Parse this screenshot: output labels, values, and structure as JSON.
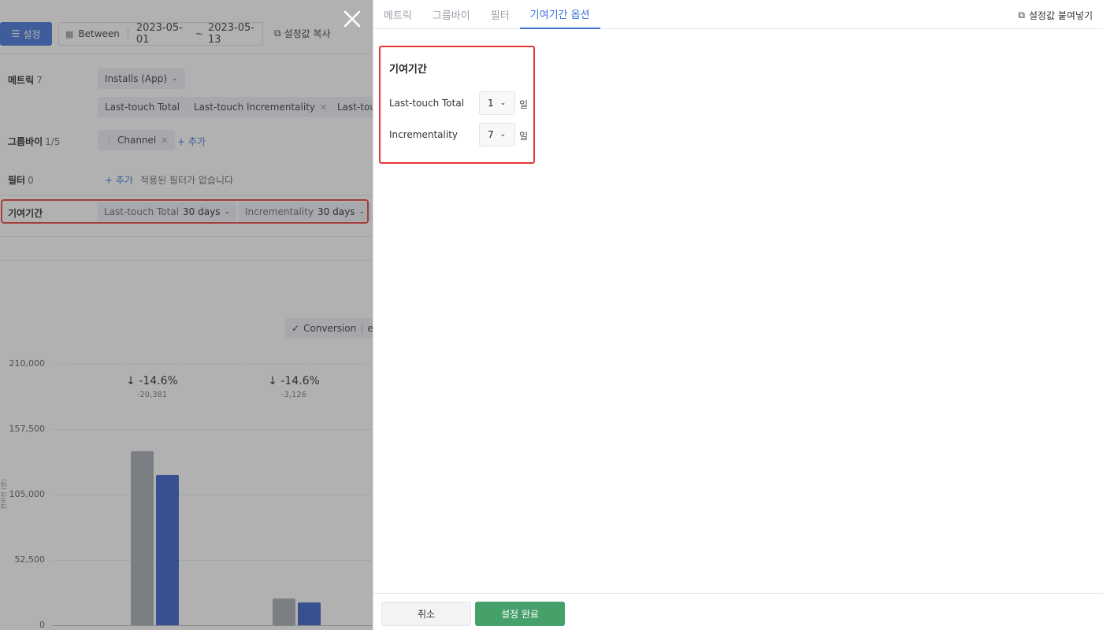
{
  "background": {
    "settings_button": "설정",
    "date_mode": "Between",
    "date_start": "2023-05-01",
    "date_tilde": "~",
    "date_end": "2023-05-13",
    "copy_settings": "설정값 복사",
    "metric_row": {
      "label": "메트릭",
      "count": "7",
      "metric": "Installs (App)",
      "chips": [
        "Last-touch Total",
        "Last-touch Incrementality",
        "Last-tou"
      ]
    },
    "groupby_row": {
      "label": "그룹바이",
      "count": "1/5",
      "chip": "Channel",
      "add": "+ 추가"
    },
    "filter_row": {
      "label": "필터",
      "count": "0",
      "add": "+ 추가",
      "empty": "적용된 필터가 없습니다"
    },
    "attribution_row": {
      "label": "기여기간",
      "chips": [
        {
          "name": "Last-touch Total",
          "value": "30 days"
        },
        {
          "name": "Incrementality",
          "value": "30 days"
        }
      ]
    },
    "legend": {
      "label": "Conversion",
      "extra": "e"
    },
    "y_axis_label": "컨버전 (명)",
    "deltas": [
      {
        "pct": "-14.6%",
        "abs": "-20,381"
      },
      {
        "pct": "-14.6%",
        "abs": "-3,126"
      }
    ]
  },
  "chart_data": {
    "type": "bar",
    "categories": [
      "",
      ""
    ],
    "yticks": [
      "210,000",
      "157,500",
      "105,000",
      "52,500",
      "0"
    ],
    "ylim": [
      0,
      210000
    ],
    "series": [
      {
        "values": [
          139500,
          120500
        ],
        "color": "#a3a8b0"
      },
      {
        "values": [
          21300,
          18400
        ],
        "color": "#2f56c8"
      }
    ]
  },
  "panel": {
    "tabs": [
      {
        "label": "메트릭",
        "active": false
      },
      {
        "label": "그룹바이",
        "active": false
      },
      {
        "label": "필터",
        "active": false
      },
      {
        "label": "기여기간 옵션",
        "active": true
      }
    ],
    "paste_settings": "설정값 붙여넣기",
    "section_title": "기여기간",
    "options": [
      {
        "label": "Last-touch Total",
        "value": "1",
        "unit": "일"
      },
      {
        "label": "Incrementality",
        "value": "7",
        "unit": "일"
      }
    ],
    "cancel": "취소",
    "confirm": "설정 완료"
  },
  "colors": {
    "accent": "#3b6fd8",
    "confirm_green": "#45a06a",
    "highlight_red": "#e53935",
    "bar_gray": "#a3a8b0",
    "bar_blue": "#2f56c8"
  }
}
